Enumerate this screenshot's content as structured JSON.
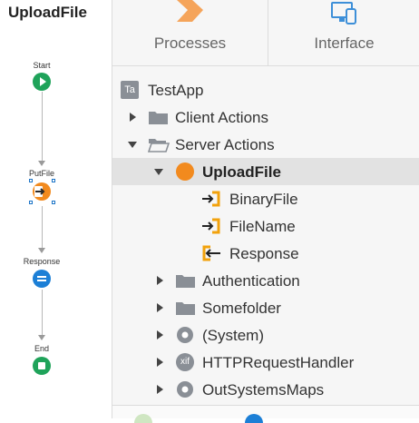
{
  "flow": {
    "title": "UploadFile",
    "nodes": [
      {
        "label": "Start"
      },
      {
        "label": "PutFile"
      },
      {
        "label": "Response"
      },
      {
        "label": "End"
      }
    ]
  },
  "tabs": [
    {
      "label": "Processes",
      "icon": "process-chevron-icon"
    },
    {
      "label": "Interface",
      "icon": "devices-icon"
    }
  ],
  "tree": {
    "app_badge": "Ta",
    "app_name": "TestApp",
    "client_actions": "Client Actions",
    "server_actions": "Server Actions",
    "upload_file": "UploadFile",
    "params": [
      "BinaryFile",
      "FileName",
      "Response"
    ],
    "folders": [
      "Authentication",
      "Somefolder"
    ],
    "system": "(System)",
    "http_handler_badge": "xif",
    "http_handler": "HTTPRequestHandler",
    "maps": "OutSystemsMaps"
  },
  "colors": {
    "accent_orange": "#f28a1e",
    "start_green": "#1fa35a",
    "assign_blue": "#1c7fd6",
    "selection": "#e2e2e2"
  }
}
